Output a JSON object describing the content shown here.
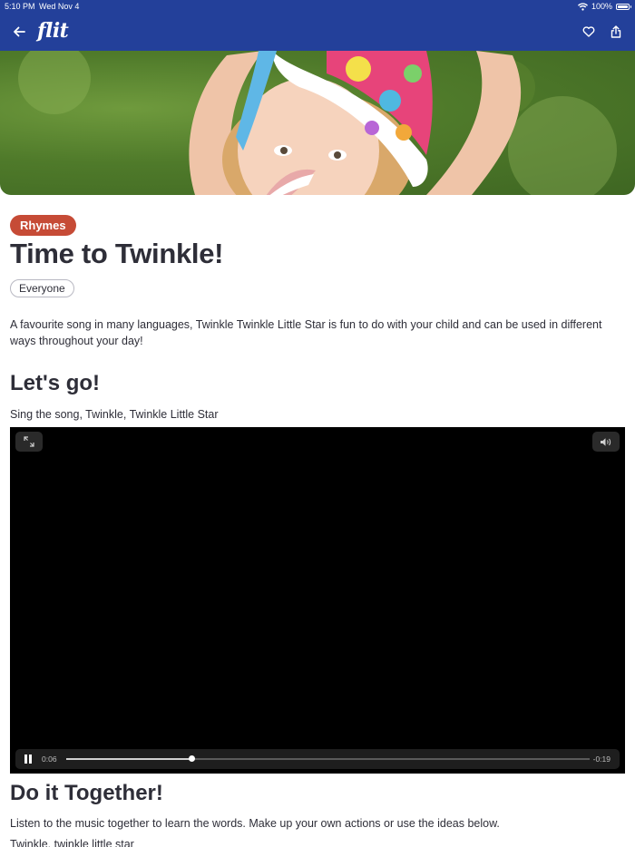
{
  "status_bar": {
    "time": "5:10 PM",
    "date": "Wed Nov 4",
    "battery": "100%",
    "battery_level": 1.0
  },
  "header": {
    "logo": "flit",
    "back_icon": "arrow-left-icon",
    "favorite_icon": "heart-outline-icon",
    "share_icon": "share-icon",
    "background": "#23409a"
  },
  "activity": {
    "category": "Rhymes",
    "category_color": "#c64b36",
    "title": "Time to Twinkle!",
    "audience": "Everyone",
    "description": "A favourite song in many languages, Twinkle Twinkle Little Star is fun to do with your child and can be used in different ways throughout your day!"
  },
  "lets_go": {
    "heading": "Let's go!",
    "text": "Sing the song, Twinkle, Twinkle Little Star"
  },
  "video": {
    "elapsed": "0:06",
    "remaining": "-0:19",
    "progress": 0.24,
    "expand_icon": "expand-icon",
    "volume_icon": "volume-icon",
    "pause_icon": "pause-icon"
  },
  "together": {
    "heading": "Do it Together!",
    "text": "Listen to the music together to learn the words. Make up your own actions or use the ideas below.",
    "lyrics_first_line": "Twinkle, twinkle little star"
  }
}
